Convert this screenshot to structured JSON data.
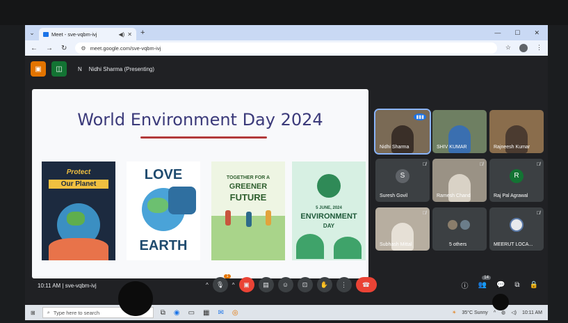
{
  "browser": {
    "tab_title": "Meet - sve-vqbm-ivj",
    "url": "meet.google.com/sve-vqbm-ivj"
  },
  "meet": {
    "presenter_initial": "N",
    "presenter_label": "Nidhi Sharma (Presenting)"
  },
  "slide": {
    "title": "World Environment Day 2024",
    "posters": [
      {
        "line1": "Protect",
        "line2": "Our Planet"
      },
      {
        "line1": "LOVE",
        "line2": "EARTH"
      },
      {
        "line1": "TOGETHER FOR A",
        "line2": "GREENER",
        "line3": "FUTURE"
      },
      {
        "line1": "5 JUNE, 2024",
        "line2": "ENVIRONMENT",
        "line3": "DAY"
      }
    ]
  },
  "participants": [
    {
      "name": "Nidhi Sharma",
      "type": "video",
      "active": true
    },
    {
      "name": "SHIV KUMAR",
      "type": "video"
    },
    {
      "name": "Rajneesh Kumar",
      "type": "video"
    },
    {
      "name": "Suresh Govil",
      "type": "avatar",
      "initial": "S",
      "color": "#5f6368"
    },
    {
      "name": "Ramesh Chand",
      "type": "video"
    },
    {
      "name": "Raj Pal Agrawal",
      "type": "avatar",
      "initial": "R",
      "color": "#137333"
    },
    {
      "name": "Subhash Mittal",
      "type": "video"
    },
    {
      "name": "5 others",
      "type": "group"
    },
    {
      "name": "MEERUT LOCA...",
      "type": "logo"
    }
  ],
  "footer": {
    "time": "10:11 AM",
    "separator": "|",
    "meeting_code": "sve-vqbm-ivj",
    "people_count": "14",
    "raise_badge": "1"
  },
  "taskbar": {
    "search_placeholder": "Type here to search",
    "weather": "35°C  Sunny",
    "clock": "10:11 AM"
  }
}
